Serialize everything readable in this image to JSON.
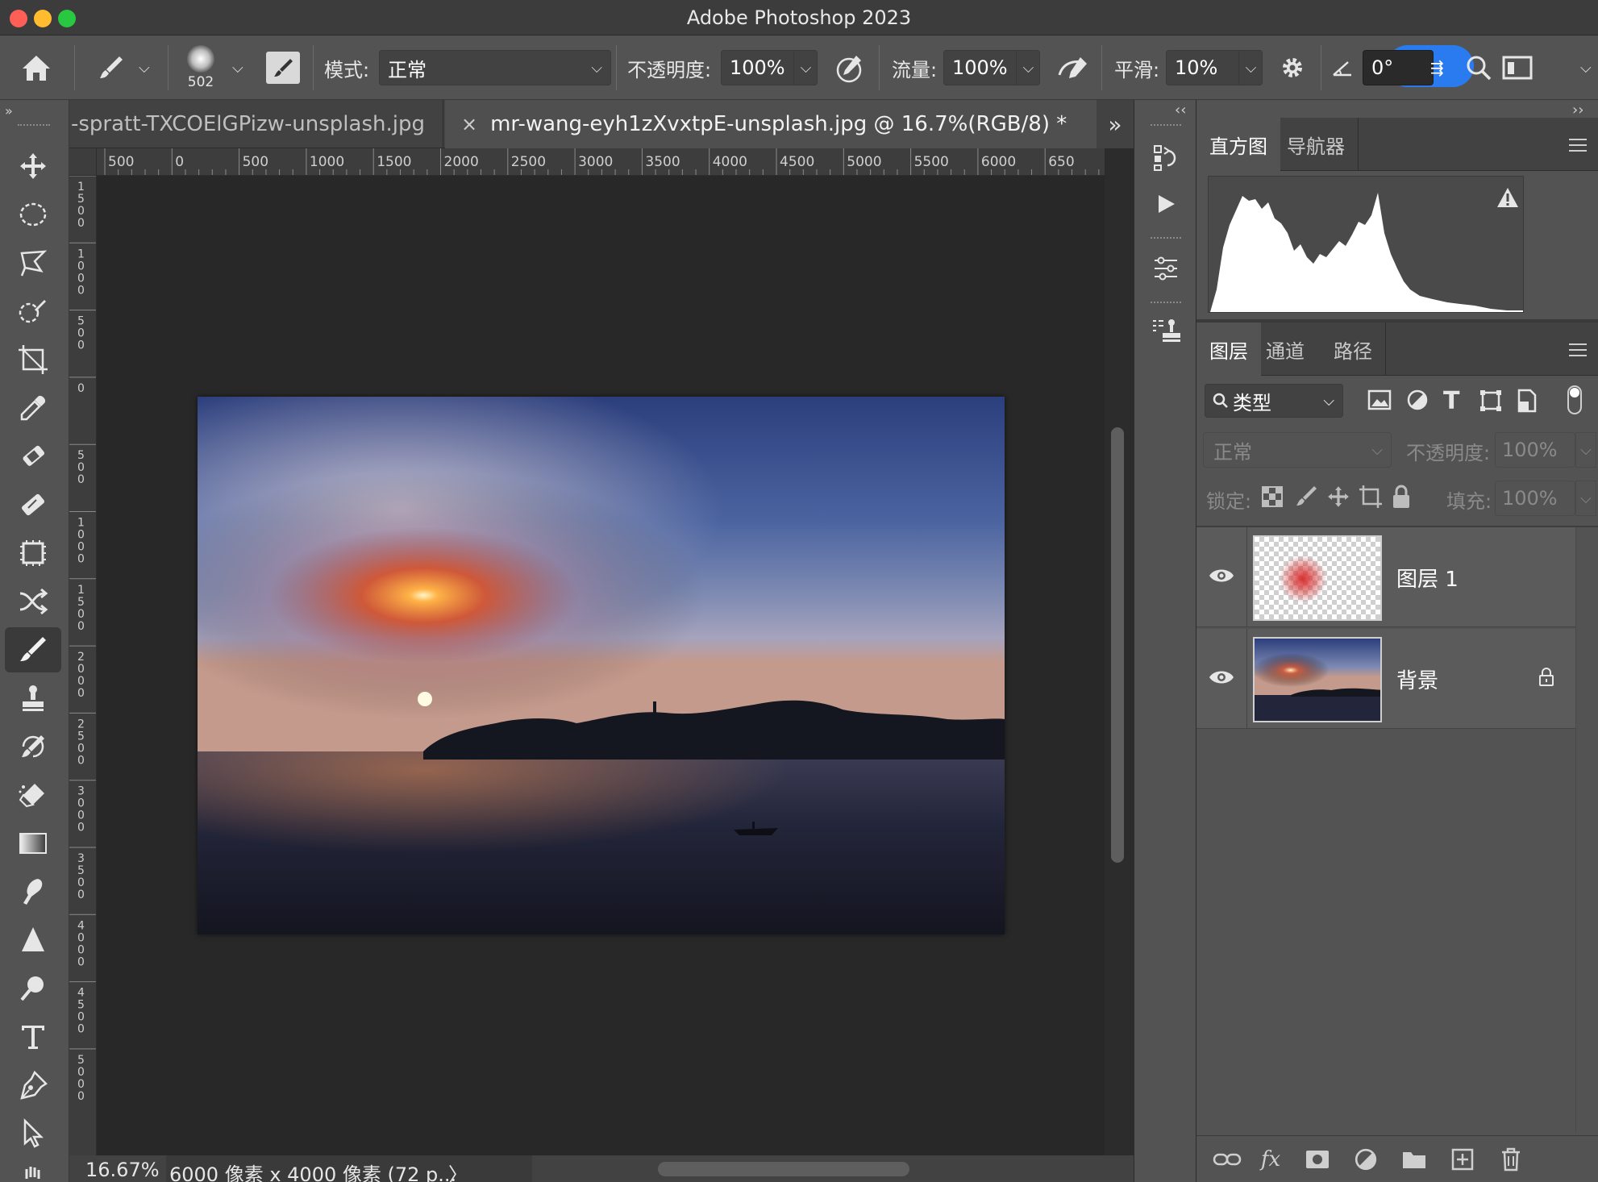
{
  "window": {
    "title": "Adobe Photoshop 2023"
  },
  "options_bar": {
    "brush_size": "502",
    "mode_label": "模式:",
    "mode_value": "正常",
    "opacity_label": "不透明度:",
    "opacity_value": "100%",
    "flow_label": "流量:",
    "flow_value": "100%",
    "smoothing_label": "平滑:",
    "smoothing_value": "10%",
    "angle_value": "0°"
  },
  "document_tabs": [
    {
      "label": "-spratt-TXCOElGPizw-unsplash.jpg",
      "active": false
    },
    {
      "label": "mr-wang-eyh1zXvxtpE-unsplash.jpg @ 16.7%(RGB/8) *",
      "active": true
    }
  ],
  "tab_close_glyph": "×",
  "tab_overflow_glyph": "»",
  "rulers": {
    "top_ticks": [
      "500",
      "0",
      "500",
      "1000",
      "1500",
      "2000",
      "2500",
      "3000",
      "3500",
      "4000",
      "4500",
      "5000",
      "5500",
      "6000",
      "650"
    ],
    "left_ticks": [
      "1500",
      "1000",
      "500",
      "0",
      "500",
      "1000",
      "1500",
      "2000",
      "2500",
      "3000",
      "3500",
      "4000",
      "4500",
      "5000"
    ]
  },
  "status_bar": {
    "zoom": "16.67%",
    "doc_info": "6000 像素 x 4000 像素 (72 p...",
    "chevron": "〉"
  },
  "histogram_panel": {
    "tabs": [
      "直方图",
      "导航器"
    ],
    "warning_icon": "warning-icon"
  },
  "layers_panel": {
    "tabs": [
      "图层",
      "通道",
      "路径"
    ],
    "filter_label": "类型",
    "blend_mode": "正常",
    "opacity_label": "不透明度:",
    "opacity_value": "100%",
    "lock_label": "锁定:",
    "fill_label": "填充:",
    "fill_value": "100%",
    "layers": [
      {
        "name": "图层 1",
        "visible": true,
        "locked": false
      },
      {
        "name": "背景",
        "visible": true,
        "locked": true
      }
    ]
  },
  "colors": {
    "accent_blue": "#2b7bf0",
    "brush_dot": "#d83030"
  }
}
